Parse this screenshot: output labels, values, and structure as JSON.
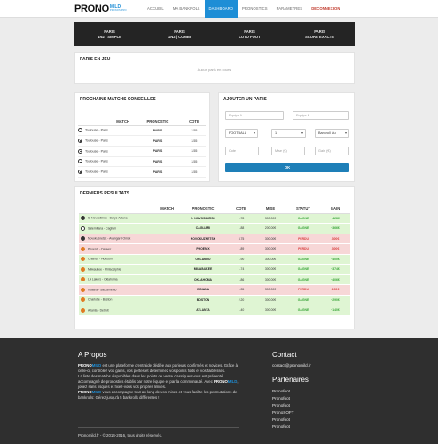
{
  "brand": {
    "name": "PRONO",
    "sub": "MILD",
    "sub_small": "PRONOS PRO"
  },
  "nav": {
    "items": [
      {
        "label": "ACCUEIL",
        "active": false
      },
      {
        "label": "MA BANKROLL",
        "active": false
      },
      {
        "label": "DASHBOARD",
        "active": true
      },
      {
        "label": "PRONOSTICS",
        "active": false
      },
      {
        "label": "PARAMETRES",
        "active": false
      },
      {
        "label": "DECONNEXION",
        "active": false
      }
    ]
  },
  "bet_types": [
    {
      "line1": "PARIS",
      "line2": "1N2 | SIMPLE"
    },
    {
      "line1": "PARIS",
      "line2": "1N2 | COMBI"
    },
    {
      "line1": "PARIS",
      "line2": "LOTO FOOT"
    },
    {
      "line1": "PARIS",
      "line2": "SCORE EXACTE"
    }
  ],
  "current_bets": {
    "title": "PARIS EN JEU",
    "empty": "Aucun paris en cours."
  },
  "upcoming": {
    "title": "PROCHAINS MATCHS CONSEILLES",
    "headers": [
      "MATCH",
      "PRONOSTIC",
      "COTE"
    ],
    "rows": [
      {
        "match": "Toulouse - Paris",
        "prono": "PARIS",
        "cote": "3.55"
      },
      {
        "match": "Toulouse - Paris",
        "prono": "PARIS",
        "cote": "3.55"
      },
      {
        "match": "Toulouse - Paris",
        "prono": "PARIS",
        "cote": "3.55"
      },
      {
        "match": "Toulouse - Paris",
        "prono": "PARIS",
        "cote": "3.55"
      },
      {
        "match": "Toulouse - Paris",
        "prono": "PARIS",
        "cote": "3.55"
      }
    ]
  },
  "add_bet": {
    "title": "AJOUTER UN PARIS",
    "team1_placeholder": "Equipe 1",
    "team2_placeholder": "Equipe 2",
    "sport_value": "FOOTBALL",
    "number_value": "1",
    "bankroll_value": "Bankroll Nu",
    "cote_placeholder": "Cote",
    "mise_placeholder": "Mise (€)",
    "gain_placeholder": "Gain (€)",
    "ok_label": "OK"
  },
  "results": {
    "title": "DERNIERS RESULTATS",
    "headers": [
      "MATCH",
      "PRONOSTIC",
      "COTE",
      "MISE",
      "STATUT",
      "GAIN"
    ],
    "rows": [
      {
        "sport": "foot",
        "match": "S. Novosibirsk - Barys Astana",
        "prono": "S. NOVOSIBIRSK",
        "cote": "1.78",
        "mise": "300.00€",
        "statut": "GAGNE",
        "gain": "+428€",
        "result": "win"
      },
      {
        "sport": "foot",
        "match": "Salernitana - Cagliari",
        "prono": "CAGLIARI",
        "cote": "1.88",
        "mise": "200.00€",
        "statut": "GAGNE",
        "gain": "+366€",
        "result": "win"
      },
      {
        "sport": "foot",
        "match": "Novokuznetsk - Avangard Omsk",
        "prono": "NOVOKUZNETSK",
        "cote": "3.75",
        "mise": "300.00€",
        "statut": "PERDU",
        "gain": "-300€",
        "result": "lose"
      },
      {
        "sport": "basket",
        "match": "Phoenix - Denver",
        "prono": "PHOENIX",
        "cote": "1.89",
        "mise": "300.00€",
        "statut": "PERDU",
        "gain": "-300€",
        "result": "lose"
      },
      {
        "sport": "basket",
        "match": "Orlando - Houston",
        "prono": "ORLANDO",
        "cote": "1.90",
        "mise": "300.00€",
        "statut": "GAGNE",
        "gain": "+400€",
        "result": "win"
      },
      {
        "sport": "basket",
        "match": "Milwaukee - Philadelphie",
        "prono": "MILWAUKEE",
        "cote": "1.74",
        "mise": "300.00€",
        "statut": "GAGNE",
        "gain": "+374€",
        "result": "win"
      },
      {
        "sport": "basket",
        "match": "LA Lakers - Oklahoma",
        "prono": "OKLAHOMA",
        "cote": "1.86",
        "mise": "300.00€",
        "statut": "GAGNE",
        "gain": "+406€",
        "result": "win"
      },
      {
        "sport": "basket",
        "match": "Indiana - Sacramento",
        "prono": "INDIANA",
        "cote": "1.35",
        "mise": "300.00€",
        "statut": "PERDU",
        "gain": "-150€",
        "result": "lose"
      },
      {
        "sport": "basket",
        "match": "Charlotte - Boston",
        "prono": "BOSTON",
        "cote": "2.20",
        "mise": "300.00€",
        "statut": "GAGNE",
        "gain": "+290€",
        "result": "win"
      },
      {
        "sport": "basket",
        "match": "Atlanta - Detroit",
        "prono": "ATLANTA",
        "cote": "1.40",
        "mise": "300.00€",
        "statut": "GAGNE",
        "gain": "+140€",
        "result": "win"
      }
    ]
  },
  "footer": {
    "about_title": "A Propos",
    "about_p1": "est une plateforme d'entraide dédiée aux parieurs confirmés et novices. Grâce à celle-ci, contrôlez vos gains, vos pertes et déterminez vos points forts et vos faiblesses.",
    "about_p2": "La liste des matchs disponibles dans les points de vente classiques vous est présenté accompagné de pronostics établis par notre équipe et par la communauté. Avec",
    "about_p2b": ", jouez sans risques et fixez-vous vos propres limites.",
    "about_p3": "vous accompagne tout au long de vos mises et vous facilite les permutations de bankrolls: Gérez jusqu'à 5 bankrolls différentes !",
    "contact_title": "Contact",
    "contact_email": "contact@pronomild.fr",
    "partners_title": "Partenaires",
    "partners": [
      "Pronofoot",
      "Pronofoot",
      "Pronofoot",
      "PronoSOFT",
      "Pronofoot",
      "Pronofoot"
    ],
    "copyright": "Pronomild.fr - © 2014-2016, tous droits réservés."
  },
  "colors": {
    "accent": "#1e8ed6",
    "danger": "#c0392b",
    "win": "#dff5d3",
    "lose": "#f7d7d7",
    "dark": "#242424"
  }
}
